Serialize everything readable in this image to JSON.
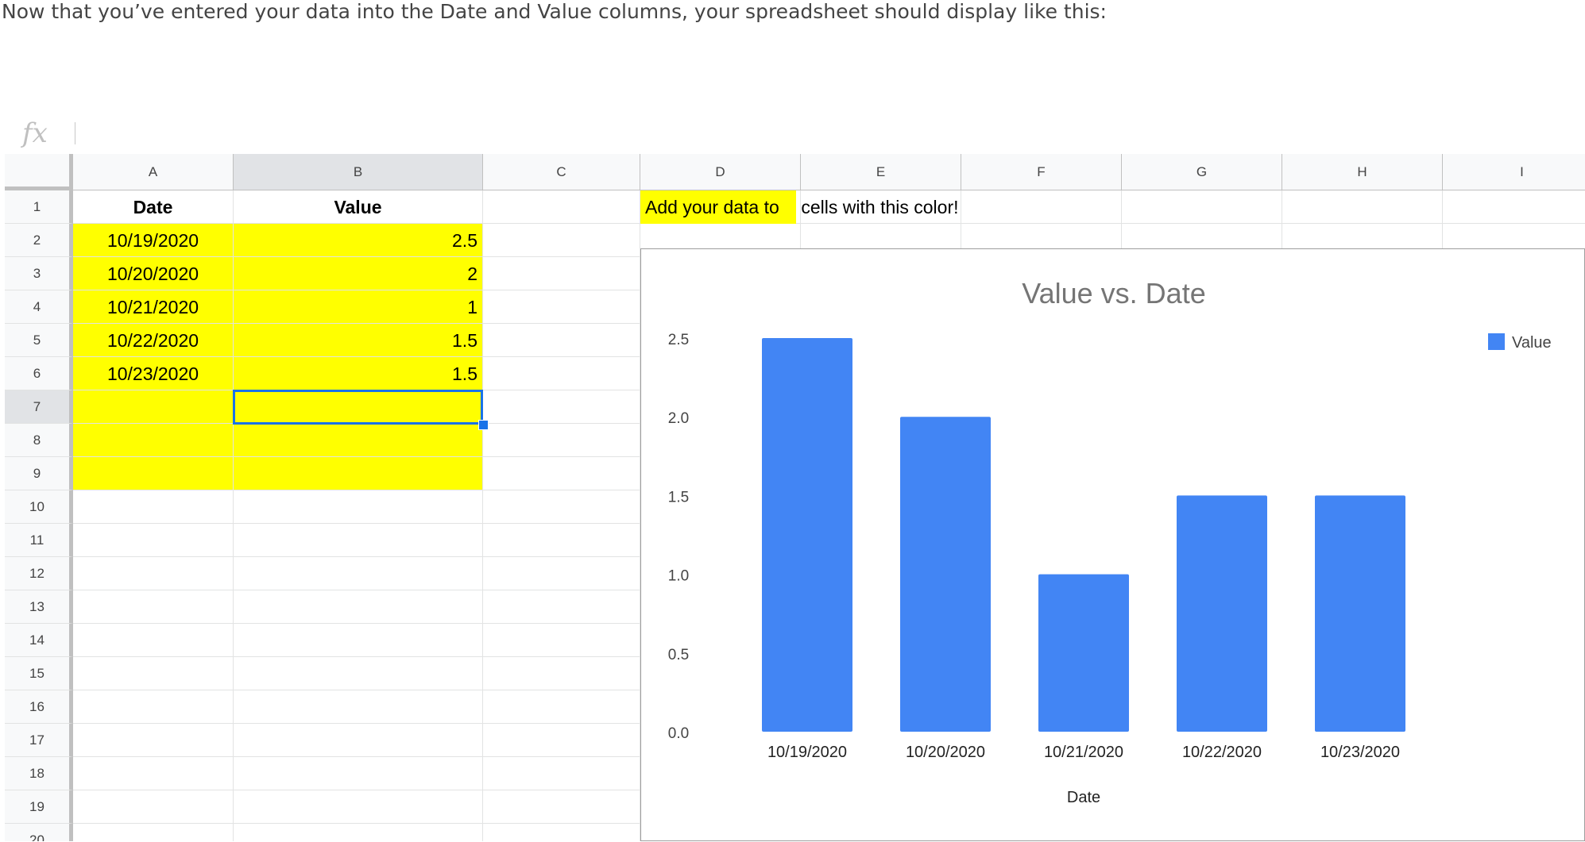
{
  "intro_text": "Now that you’ve entered your data into the Date and Value columns, your spreadsheet should display like this:",
  "formula_bar": {
    "icon": "fx",
    "value": ""
  },
  "columns": [
    "A",
    "B",
    "C",
    "D",
    "E",
    "F",
    "G",
    "H",
    "I"
  ],
  "rows": [
    "1",
    "2",
    "3",
    "4",
    "5",
    "6",
    "7",
    "8",
    "9",
    "10",
    "11",
    "12",
    "13",
    "14",
    "15",
    "16",
    "17",
    "18",
    "19",
    "20"
  ],
  "cells": {
    "A1": "Date",
    "B1": "Value",
    "A2": "10/19/2020",
    "B2": "2.5",
    "A3": "10/20/2020",
    "B3": "2",
    "A4": "10/21/2020",
    "B4": "1",
    "A5": "10/22/2020",
    "B5": "1.5",
    "A6": "10/23/2020",
    "B6": "1.5",
    "D1_highlight": "Add your data to",
    "D1_rest": " cells with this color!"
  },
  "selected_cell": "B7",
  "colors": {
    "highlight": "#ffff00",
    "bar": "#4285f4",
    "selection": "#1a73e8"
  },
  "chart_data": {
    "type": "bar",
    "title": "Value vs. Date",
    "xlabel": "Date",
    "ylabel": "",
    "categories": [
      "10/19/2020",
      "10/20/2020",
      "10/21/2020",
      "10/22/2020",
      "10/23/2020"
    ],
    "series": [
      {
        "name": "Value",
        "values": [
          2.5,
          2,
          1,
          1.5,
          1.5
        ],
        "color": "#4285f4"
      }
    ],
    "yticks": [
      "0.0",
      "0.5",
      "1.0",
      "1.5",
      "2.0",
      "2.5"
    ],
    "ylim": [
      0,
      2.5
    ],
    "legend": "top-right",
    "grid": false
  }
}
